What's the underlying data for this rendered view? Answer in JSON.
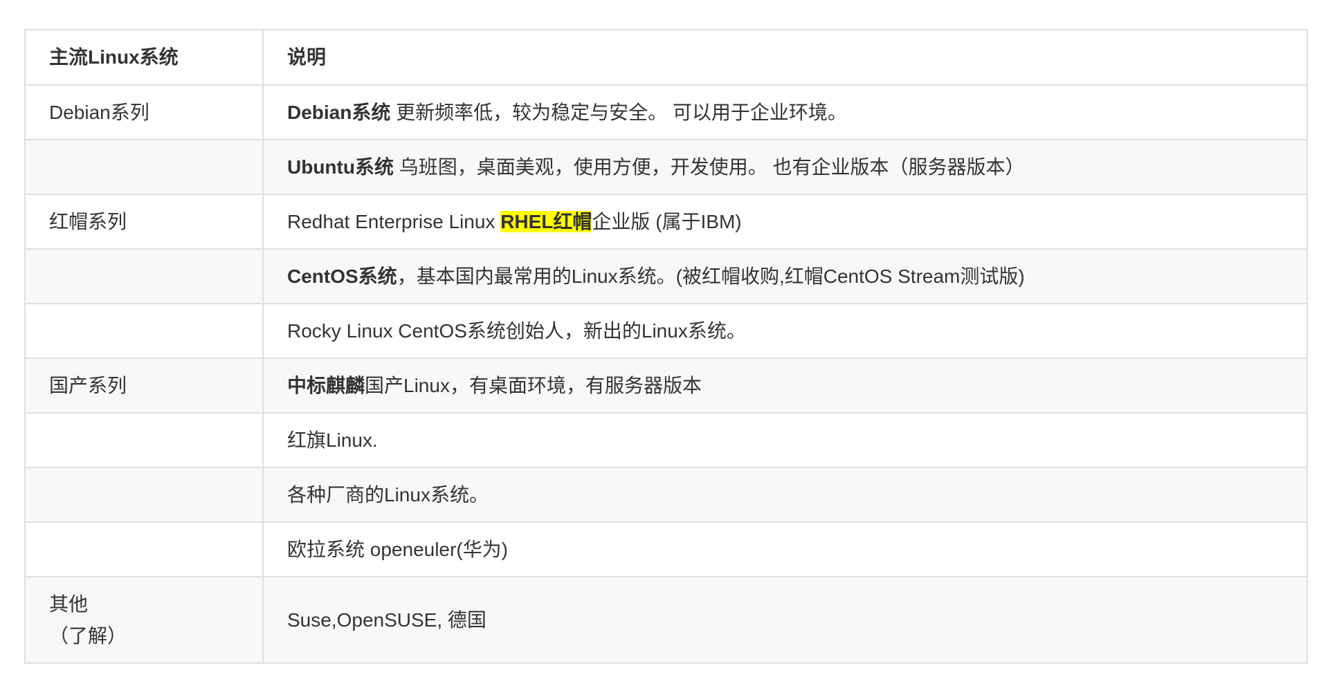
{
  "table": {
    "headers": [
      "主流Linux系统",
      "说明"
    ],
    "rows": [
      {
        "category": "Debian系列",
        "desc_strong": "Debian系统",
        "desc_rest": " 更新频率低，较为稳定与安全。 可以用于企业环境。"
      },
      {
        "category": "",
        "desc_strong": "Ubuntu系统",
        "desc_rest": " 乌班图，桌面美观，使用方便，开发使用。 也有企业版本（服务器版本）"
      },
      {
        "category": "红帽系列",
        "desc_pre": "Redhat Enterprise Linux ",
        "desc_highlight": "RHEL红帽",
        "desc_rest": "企业版 (属于IBM)"
      },
      {
        "category": "",
        "desc_strong": "CentOS系统",
        "desc_rest": "，基本国内最常用的Linux系统。(被红帽收购,红帽CentOS Stream测试版)"
      },
      {
        "category": "",
        "desc_text": "Rocky Linux CentOS系统创始人，新出的Linux系统。"
      },
      {
        "category": "国产系列",
        "desc_strong": "中标麒麟",
        "desc_rest": "国产Linux，有桌面环境，有服务器版本"
      },
      {
        "category": "",
        "desc_text": "红旗Linux."
      },
      {
        "category": "",
        "desc_text": "各种厂商的Linux系统。"
      },
      {
        "category": "",
        "desc_text": "欧拉系统 openeuler(华为)"
      },
      {
        "category_line1": "其他",
        "category_line2": "（了解）",
        "desc_text": "Suse,OpenSUSE, 德国"
      }
    ]
  },
  "colors": {
    "border": "#dfdfdf",
    "alt_row": "#f8f8f8",
    "highlight": "#ffff00",
    "text": "#333333"
  }
}
